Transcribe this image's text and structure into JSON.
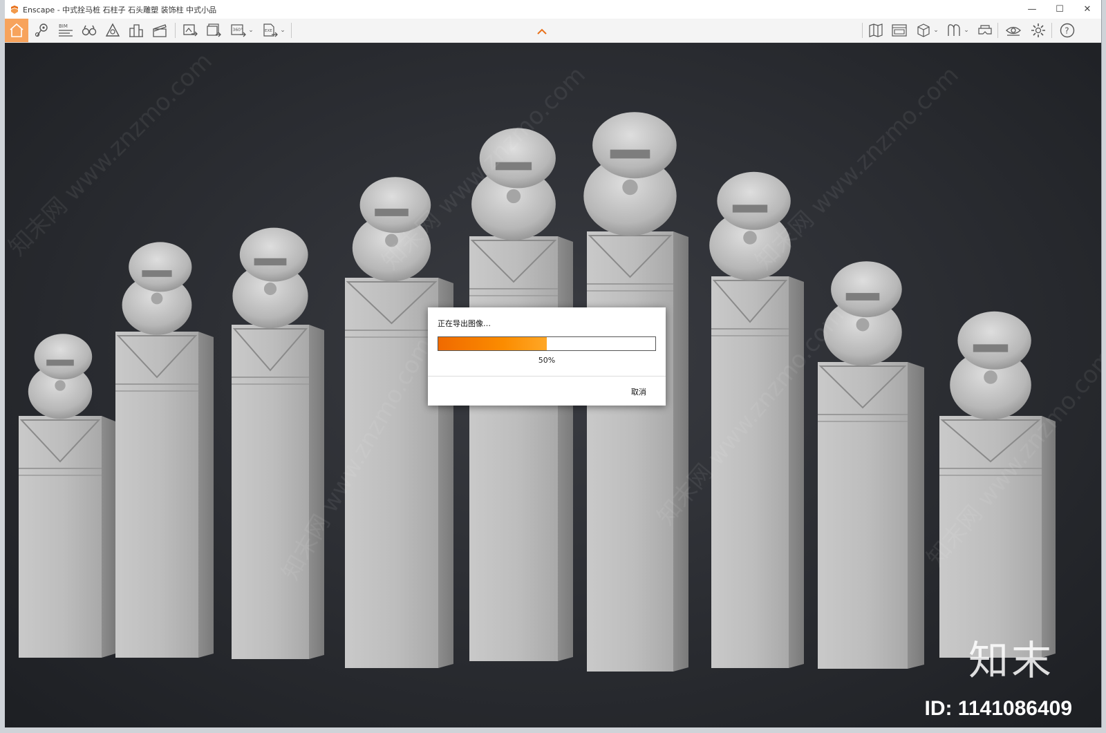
{
  "window": {
    "title": "Enscape - 中式拴马桩 石柱子 石头雕塑 装饰柱 中式小品",
    "controls": [
      "—",
      "☐",
      "✕"
    ]
  },
  "toolbar": {
    "left_tools": [
      {
        "name": "home-icon"
      },
      {
        "name": "location-pin-icon"
      },
      {
        "name": "bim-icon",
        "label": "BIM"
      },
      {
        "name": "binoculars-icon"
      },
      {
        "name": "atmosphere-icon"
      },
      {
        "name": "buildings-icon"
      },
      {
        "name": "clapperboard-icon"
      },
      {
        "name": "screenshot-export-icon"
      },
      {
        "name": "batch-render-icon"
      },
      {
        "name": "panorama-360-icon",
        "label": "360°"
      },
      {
        "name": "exe-export-icon",
        "label": "EXE"
      }
    ],
    "right_tools": [
      {
        "name": "map-icon"
      },
      {
        "name": "window-view-icon"
      },
      {
        "name": "cube-icon"
      },
      {
        "name": "asset-library-icon"
      },
      {
        "name": "vr-headset-icon"
      },
      {
        "name": "visual-settings-eye-icon"
      },
      {
        "name": "settings-gear-icon"
      },
      {
        "name": "help-icon",
        "label": "?"
      }
    ],
    "collapse_icon": "chevron-up-icon",
    "accent": "#f7a35c"
  },
  "dialog": {
    "title": "正在导出图像…",
    "progress": 0.5,
    "percent_label": "50%",
    "cancel_label": "取消",
    "progress_color": "#f57c00"
  },
  "watermark": {
    "brand": "知末",
    "id": "ID: 1141086409",
    "diagonal_text": "知末网 www.znzmo.com"
  }
}
